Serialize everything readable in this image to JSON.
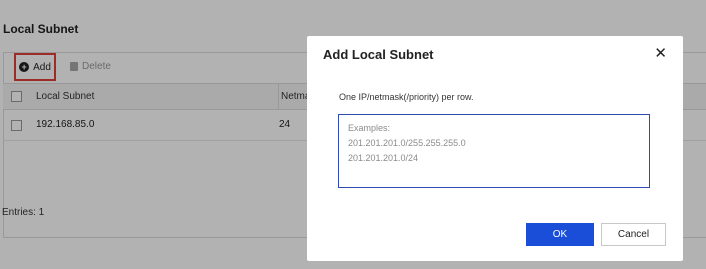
{
  "page": {
    "section_title": "Local Subnet",
    "toolbar": {
      "add_label": "Add",
      "delete_label": "Delete"
    },
    "table": {
      "columns": [
        "Local Subnet",
        "Netmask"
      ],
      "rows": [
        {
          "subnet": "192.168.85.0",
          "netmask": "24"
        }
      ]
    },
    "entries_label": "Entries: 1"
  },
  "dialog": {
    "title": "Add Local Subnet",
    "hint": "One IP/netmask(/priority) per row.",
    "textarea": {
      "value": "",
      "placeholder_lines": [
        "Examples:",
        "201.201.201.0/255.255.255.0",
        "201.201.201.0/24"
      ]
    },
    "ok_label": "OK",
    "cancel_label": "Cancel"
  },
  "colors": {
    "primary": "#1b4ed8",
    "highlight": "#e0403a",
    "overlay": "rgba(0,0,0,0.30)"
  },
  "icons": {
    "add": "plus-circle-icon",
    "delete": "trash-icon",
    "close": "close-icon"
  }
}
